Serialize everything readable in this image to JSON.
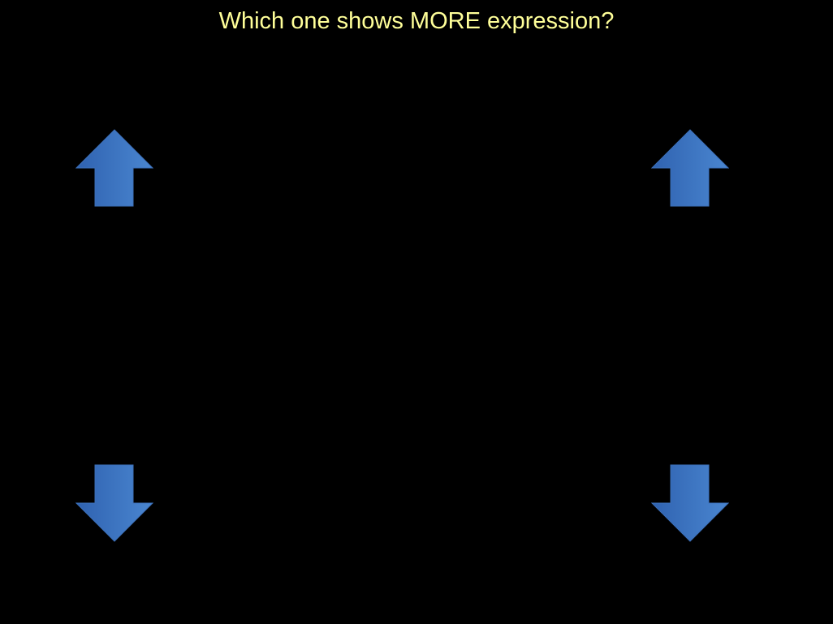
{
  "slide": {
    "question": "Which one shows MORE expression?",
    "colors": {
      "background": "#000000",
      "question_text": "#ffff99",
      "arrow_fill_dark": "#2f62b0",
      "arrow_fill_light": "#4a86d0",
      "arrow_stroke": "#3c6fb8"
    },
    "arrows": [
      {
        "icon": "arrow-up-icon",
        "direction": "up"
      },
      {
        "icon": "arrow-up-icon",
        "direction": "up"
      },
      {
        "icon": "arrow-down-icon",
        "direction": "down"
      },
      {
        "icon": "arrow-down-icon",
        "direction": "down"
      }
    ]
  }
}
